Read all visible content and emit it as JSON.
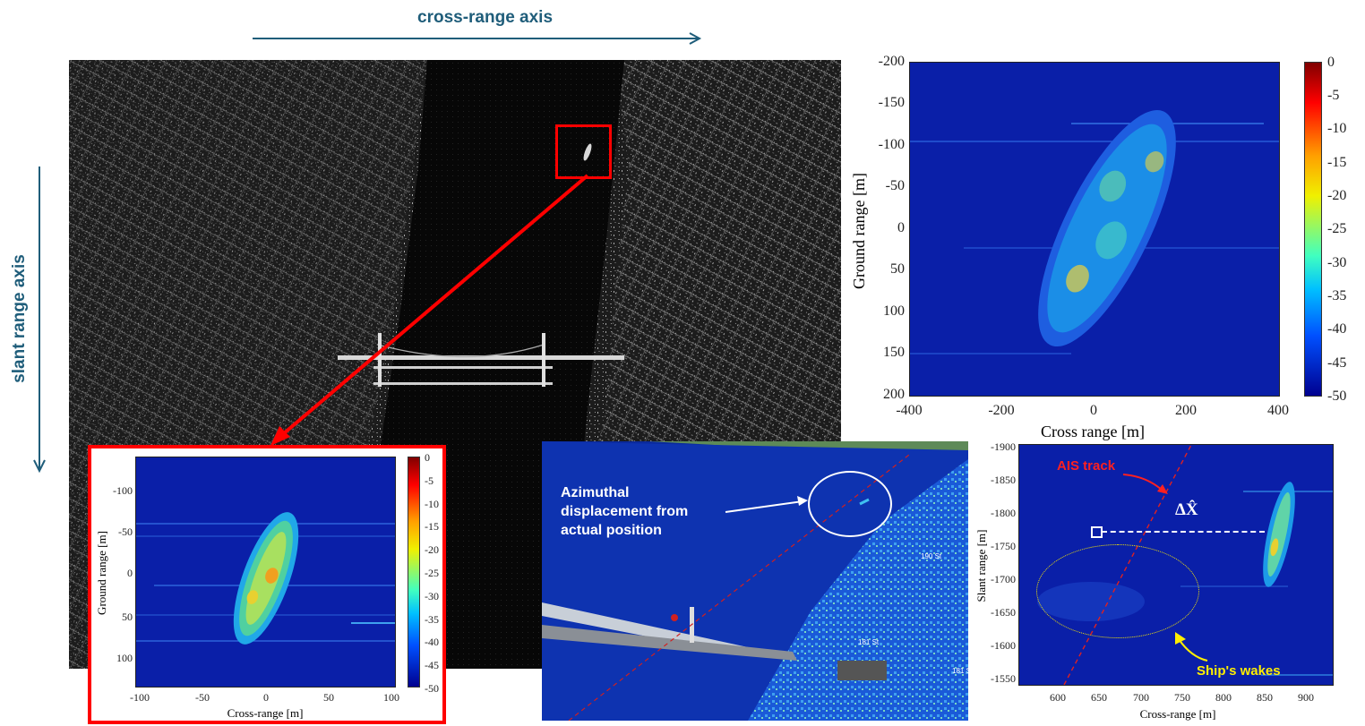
{
  "header": {
    "cross_range_axis": "cross-range axis",
    "slant_range_axis": "slant range axis"
  },
  "main_plot": {
    "xlabel": "Cross range [m]",
    "ylabel": "Ground range [m]",
    "xticks": [
      "-400",
      "-200",
      "0",
      "200",
      "400"
    ],
    "yticks": [
      "-200",
      "-150",
      "-100",
      "-50",
      "0",
      "50",
      "100",
      "150",
      "200"
    ],
    "colorbar_ticks": [
      "0",
      "-5",
      "-10",
      "-15",
      "-20",
      "-25",
      "-30",
      "-35",
      "-40",
      "-45",
      "-50"
    ]
  },
  "inset_plot": {
    "xlabel": "Cross-range [m]",
    "ylabel": "Ground range [m]",
    "xticks": [
      "-100",
      "-50",
      "0",
      "50",
      "100"
    ],
    "yticks": [
      "-100",
      "-50",
      "0",
      "50",
      "100"
    ],
    "colorbar_ticks": [
      "0",
      "-5",
      "-10",
      "-15",
      "-20",
      "-25",
      "-30",
      "-35",
      "-40",
      "-45",
      "-50"
    ]
  },
  "overlay": {
    "annotation": "Azimuthal displacement from actual position",
    "poi_labels": [
      "190 St",
      "181 St",
      "181 St"
    ]
  },
  "slant_plot": {
    "xlabel": "Cross-range [m]",
    "ylabel": "Slant range [m]",
    "xticks": [
      "600",
      "650",
      "700",
      "750",
      "800",
      "850",
      "900"
    ],
    "yticks": [
      "-1900",
      "-1850",
      "-1800",
      "-1750",
      "-1700",
      "-1650",
      "-1600",
      "-1550"
    ],
    "ais_label": "AIS track",
    "delta_label": "ΔX̂",
    "wakes_label": "Ship's wakes"
  },
  "colors": {
    "axis_arrow": "#1f5d7a",
    "highlight": "#ff0000",
    "plot_background": "#0a1fa8",
    "wakes": "#ffee00"
  }
}
